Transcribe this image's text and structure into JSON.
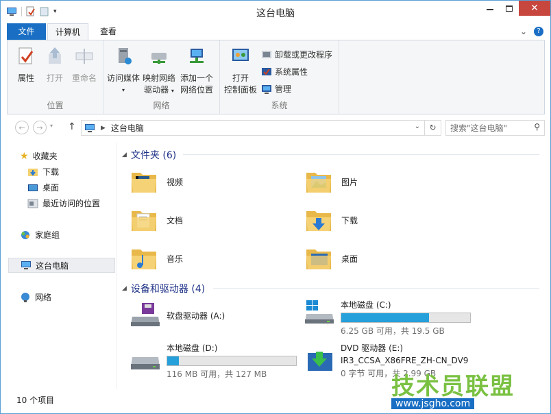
{
  "window": {
    "title": "这台电脑"
  },
  "ribbon_tabs": {
    "file": "文件",
    "computer": "计算机",
    "view": "查看"
  },
  "ribbon": {
    "groups": {
      "location": "位置",
      "network": "网络",
      "system": "系统"
    },
    "buttons": {
      "properties": "属性",
      "open": "打开",
      "rename": "重命名",
      "access_media": "访问媒体",
      "map_drive_1": "映射网络",
      "map_drive_2": "驱动器",
      "add_location_1": "添加一个",
      "add_location_2": "网络位置",
      "open_cp_1": "打开",
      "open_cp_2": "控制面板",
      "uninstall": "卸载或更改程序",
      "system_props": "系统属性",
      "manage": "管理"
    }
  },
  "address": {
    "path": "这台电脑",
    "search_placeholder": "搜索\"这台电脑\""
  },
  "nav": {
    "favorites": "收藏夹",
    "downloads": "下载",
    "desktop": "桌面",
    "recent": "最近访问的位置",
    "homegroup": "家庭组",
    "this_pc": "这台电脑",
    "network": "网络"
  },
  "folders_header": "文件夹 (6)",
  "folders": [
    {
      "name": "视频",
      "icon": "video-folder-icon"
    },
    {
      "name": "图片",
      "icon": "pictures-folder-icon"
    },
    {
      "name": "文档",
      "icon": "documents-folder-icon"
    },
    {
      "name": "下载",
      "icon": "downloads-folder-icon"
    },
    {
      "name": "音乐",
      "icon": "music-folder-icon"
    },
    {
      "name": "桌面",
      "icon": "desktop-folder-icon"
    }
  ],
  "devices_header": "设备和驱动器 (4)",
  "drives": {
    "floppy": {
      "name": "软盘驱动器 (A:)"
    },
    "c": {
      "name": "本地磁盘 (C:)",
      "space": "6.25 GB 可用，共 19.5 GB",
      "used_fraction": 0.68
    },
    "d": {
      "name": "本地磁盘 (D:)",
      "space": "116 MB 可用，共 127 MB",
      "used_fraction": 0.09
    },
    "dvd": {
      "name": "DVD 驱动器 (E:)",
      "label": "IR3_CCSA_X86FRE_ZH-CN_DV9",
      "space": "0 字节 可用，共 2.99 GB"
    }
  },
  "status": {
    "items": "10 个项目"
  },
  "watermark": {
    "text": "技术员联盟",
    "site": "www.jsgho.com"
  },
  "colors": {
    "accent": "#1a6fc4",
    "bar": "#26a0da",
    "close": "#c7463e",
    "group_header": "#1e3287"
  }
}
